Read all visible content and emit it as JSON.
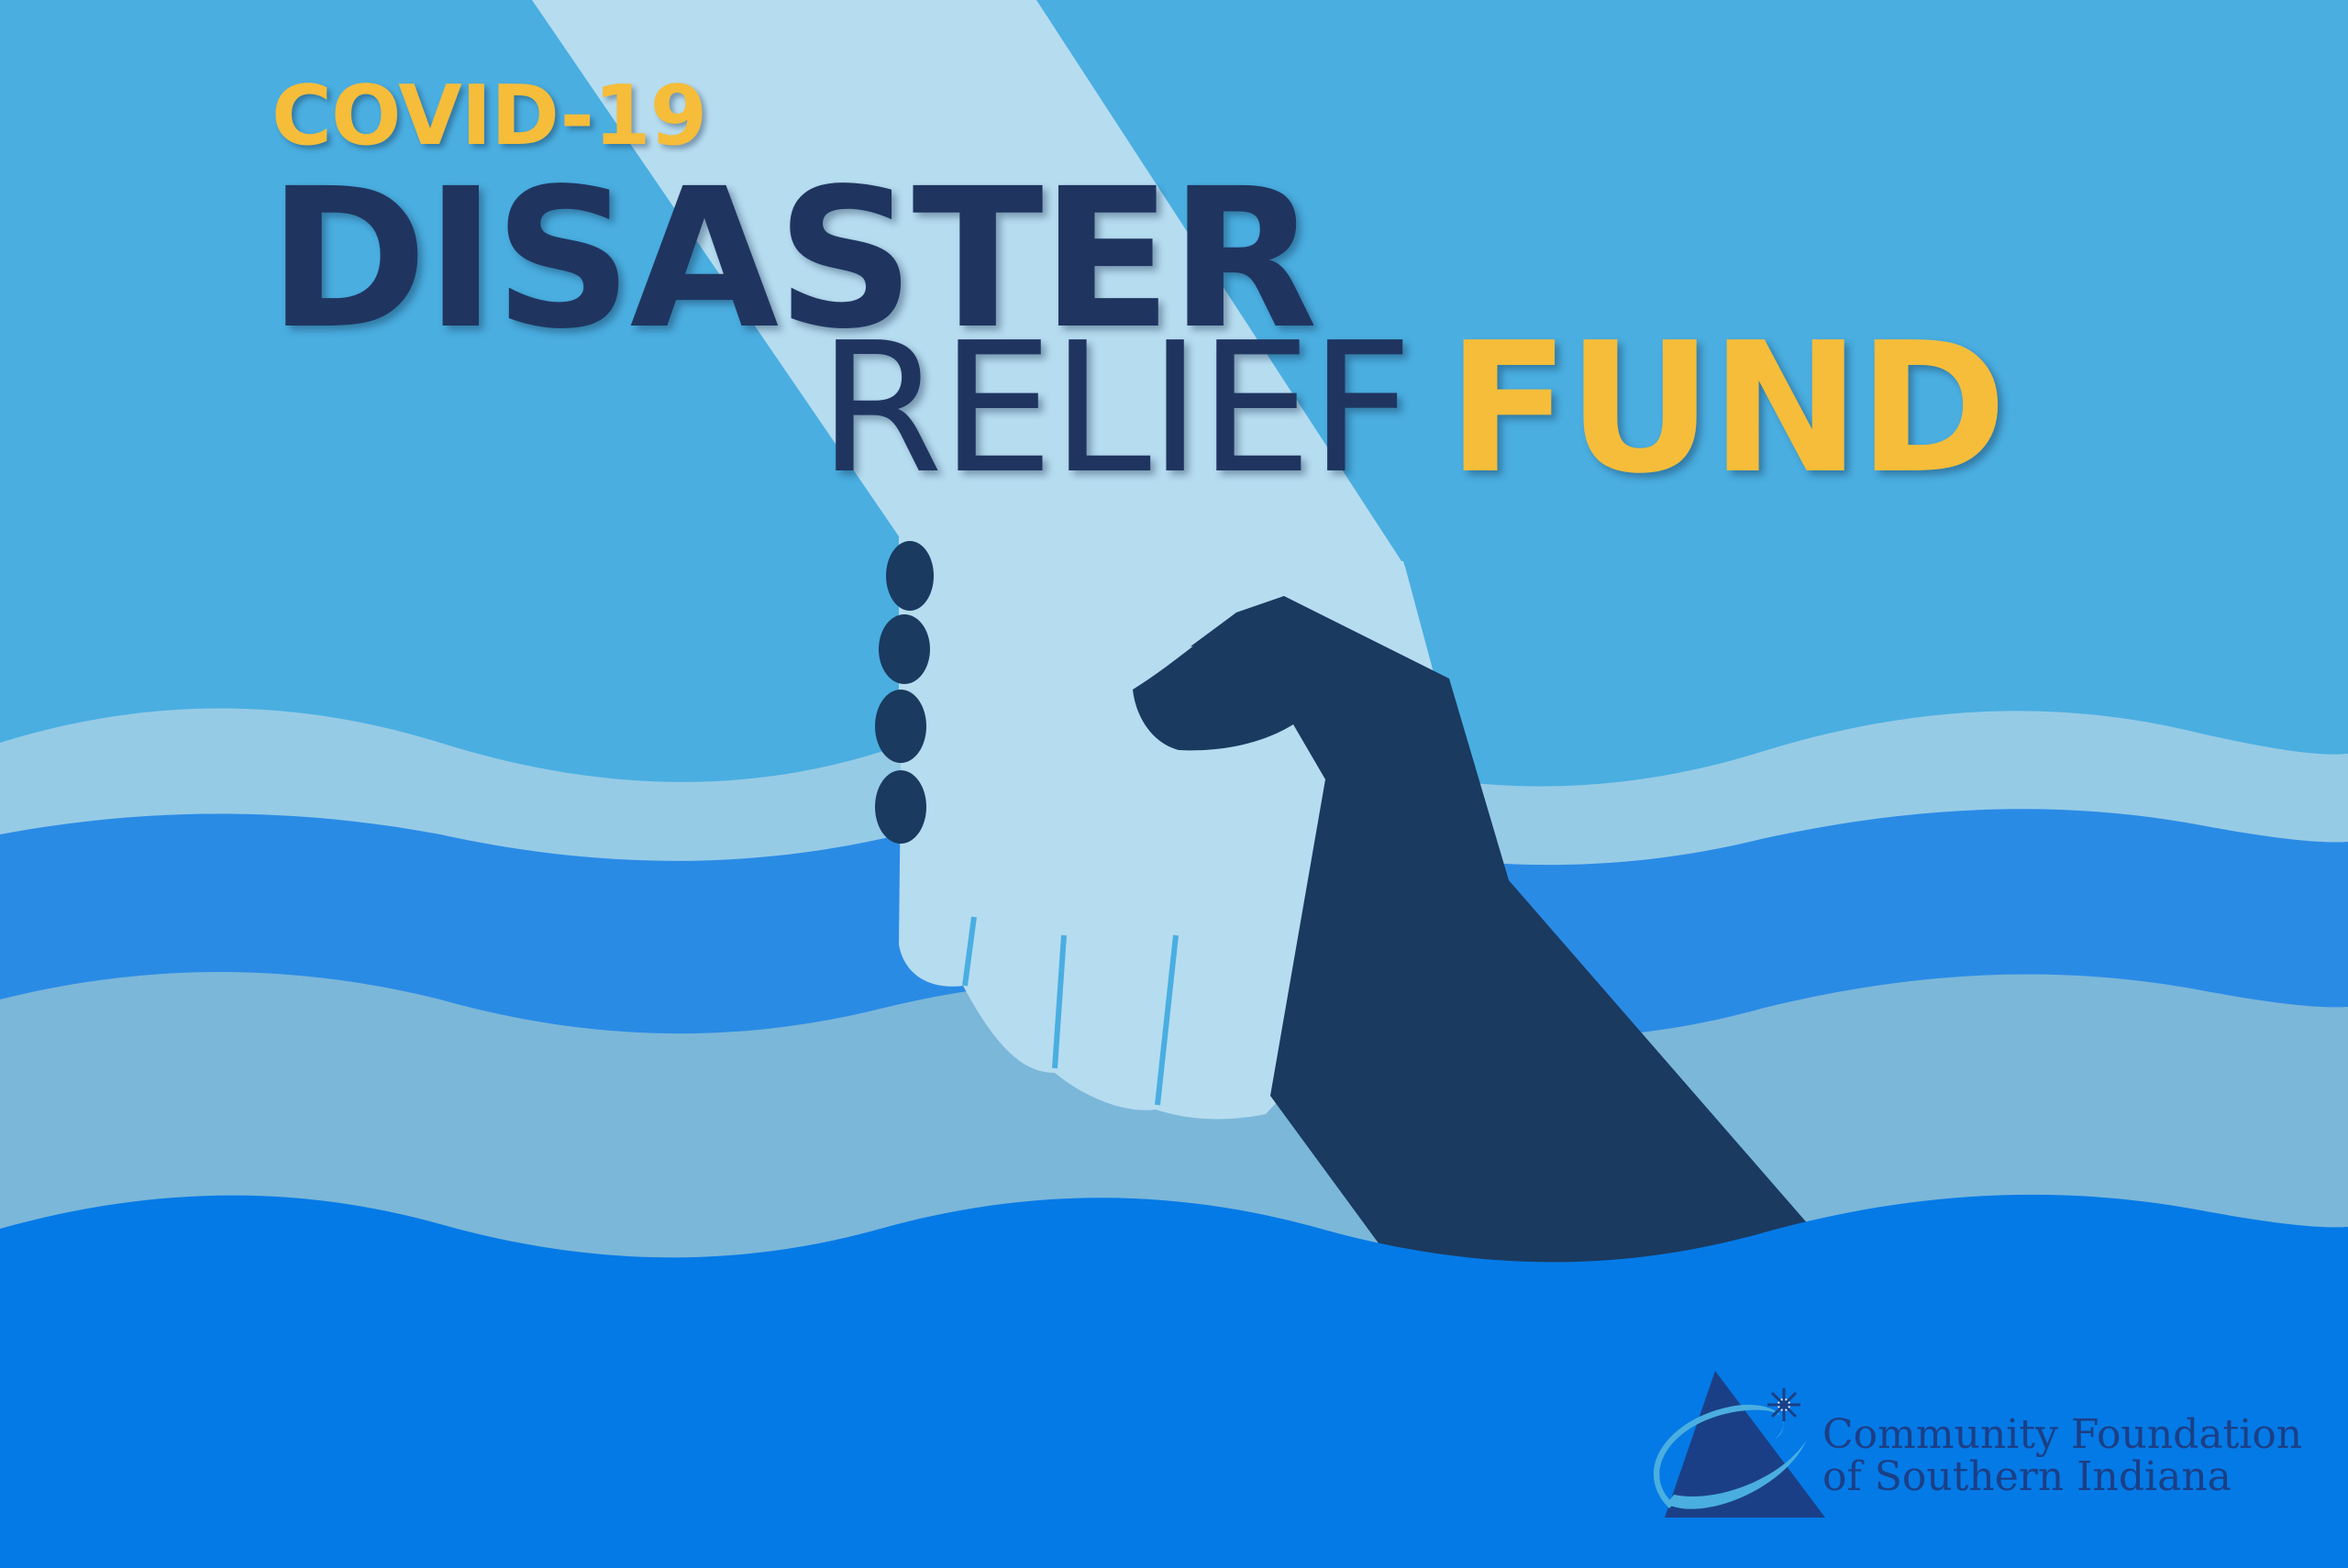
{
  "title": {
    "kicker": "COVID-19",
    "main": "DISASTER",
    "second": "RELIEF",
    "accent": "FUND"
  },
  "organization": {
    "line1": "Community Foundation",
    "line2": "of Southern Indiana"
  },
  "colors": {
    "sky": "#4aaee0",
    "wave_light": "#96cbe6",
    "wave_mid": "#2a8be5",
    "wave_pale": "#7bb7d9",
    "water": "#047ae6",
    "helper_arm": "#b6dcf0",
    "rescued_arm": "#1a3a60",
    "title_navy": "#1f3560",
    "title_gold": "#f5bd3a",
    "logo_blue": "#1b3f86"
  },
  "icons": {
    "logo": "triangle-swoosh-star-icon"
  }
}
